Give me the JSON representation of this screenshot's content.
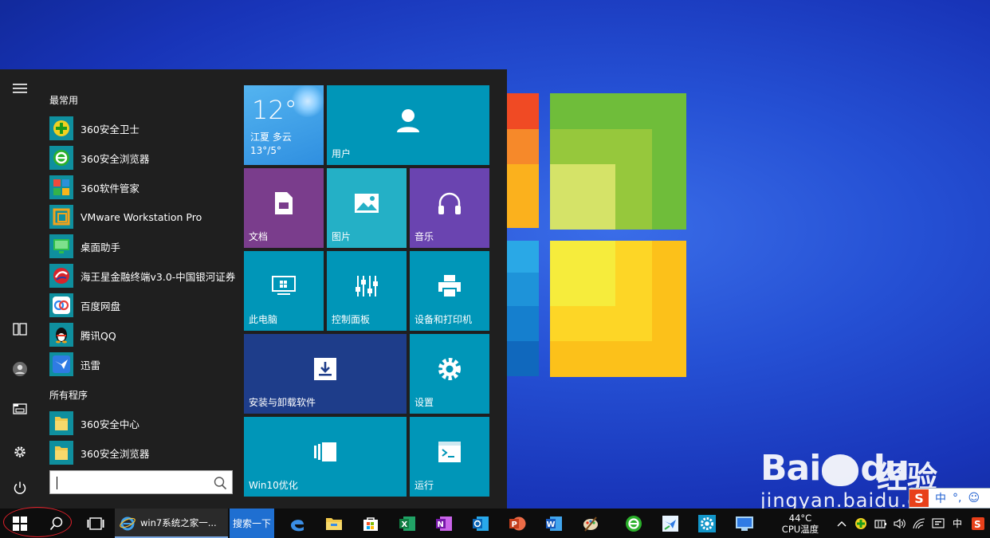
{
  "start_menu": {
    "section_frequent": "最常用",
    "section_all": "所有程序",
    "frequent_apps": [
      {
        "label": "360安全卫士",
        "icon": "360-safeguard-icon",
        "color": "#1aa11a"
      },
      {
        "label": "360安全浏览器",
        "icon": "360-browser-icon",
        "color": "#1ea51e"
      },
      {
        "label": "360软件管家",
        "icon": "360-software-manager-icon",
        "color": "#2b90d9"
      },
      {
        "label": "VMware Workstation Pro",
        "icon": "vmware-icon",
        "color": "#f2a31b"
      },
      {
        "label": "桌面助手",
        "icon": "desktop-assistant-icon",
        "color": "#27b23e"
      },
      {
        "label": "海王星金融终端v3.0-中国银河证券",
        "icon": "neptune-finance-icon",
        "color": "#d8242b"
      },
      {
        "label": "百度网盘",
        "icon": "baidu-netdisk-icon",
        "color": "#2e86f0"
      },
      {
        "label": "腾讯QQ",
        "icon": "qq-penguin-icon",
        "color": "#111111"
      },
      {
        "label": "迅雷",
        "icon": "xunlei-bird-icon",
        "color": "#2f7be4"
      }
    ],
    "all_apps": [
      {
        "label": "360安全中心",
        "icon": "folder-icon"
      },
      {
        "label": "360安全浏览器",
        "icon": "folder-icon"
      }
    ],
    "tiles": {
      "weather_temp": "12°",
      "weather_location": "江夏 多云",
      "weather_range": "13°/5°",
      "user": "用户",
      "documents": "文档",
      "pictures": "图片",
      "music": "音乐",
      "this_pc": "此电脑",
      "control_panel": "控制面板",
      "devices_printers": "设备和打印机",
      "install_uninstall": "安装与卸载软件",
      "settings": "设置",
      "win10_optimize": "Win10优化",
      "run": "运行"
    }
  },
  "taskbar": {
    "ie_window_title": "win7系统之家一...",
    "search_button": "搜索一下",
    "cpu_temp": "44°C",
    "cpu_label": "CPU温度",
    "ime_indicator": "中"
  },
  "watermark": {
    "logo_left": "Bai",
    "logo_right": "du",
    "logo_cn": "经验",
    "url": "jingyan.baidu.com"
  },
  "ime_bar": {
    "lang": "中",
    "punct": "°,",
    "emoji": "☺"
  },
  "colors": {
    "tile_cyan": "#0096b8",
    "tile_purple_doc": "#7a3d8c",
    "tile_purple_music": "#6a44b0",
    "tile_navy": "#1e3d8a",
    "taskbar": "#0d0d0d",
    "start_bg": "#1f1f1f"
  }
}
